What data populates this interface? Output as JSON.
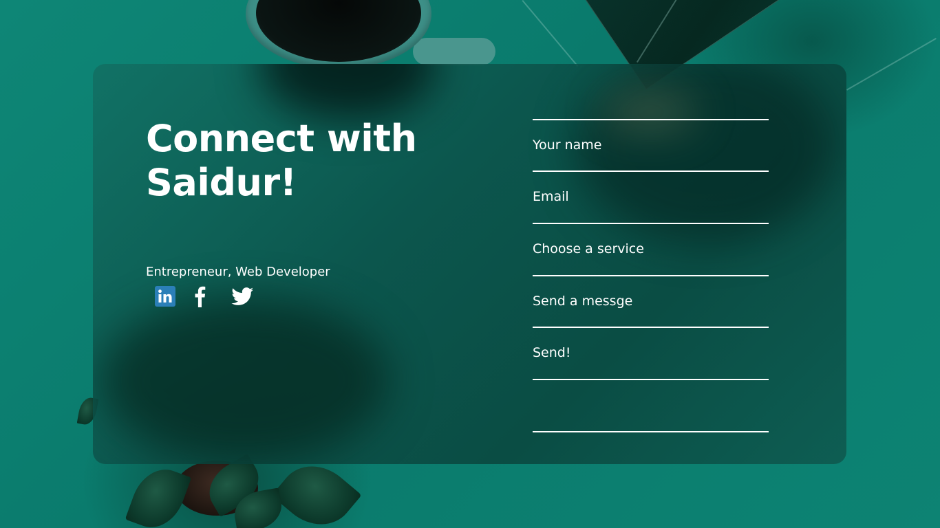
{
  "hero": {
    "title_line1": "Connect with",
    "title_line2": "Saidur!",
    "subtitle": "Entrepreneur, Web Developer"
  },
  "social": [
    {
      "icon": "linkedin-icon",
      "label": "in",
      "color": "#2b7fb8"
    },
    {
      "icon": "facebook-icon",
      "label": "f",
      "color": "#ffffff"
    },
    {
      "icon": "twitter-icon",
      "color": "#ffffff"
    }
  ],
  "form": {
    "name_placeholder": "Your name",
    "email_placeholder": "Email",
    "service_placeholder": "Choose a service",
    "message_placeholder": "Send a messge",
    "send_label": "Send!"
  },
  "colors": {
    "background": "#0a7a6c",
    "card": "#0c5048",
    "text": "#ffffff",
    "linkedin": "#2b7fb8"
  }
}
